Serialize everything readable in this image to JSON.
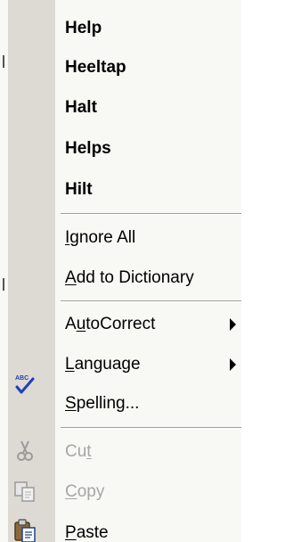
{
  "menu": {
    "suggestions": [
      {
        "label": "Help"
      },
      {
        "label": "Heeltap"
      },
      {
        "label": "Halt"
      },
      {
        "label": "Helps"
      },
      {
        "label": "Hilt"
      }
    ],
    "ignore_all": {
      "pre": "",
      "accel": "I",
      "post": "gnore All"
    },
    "add_to_dictionary": {
      "pre": "",
      "accel": "A",
      "post": "dd to Dictionary"
    },
    "autocorrect": {
      "pre": "A",
      "accel": "u",
      "post": "toCorrect"
    },
    "language": {
      "pre": "",
      "accel": "L",
      "post": "anguage"
    },
    "spelling": {
      "pre": "",
      "accel": "S",
      "post": "pelling..."
    },
    "cut": {
      "pre": "Cu",
      "accel": "t",
      "post": "",
      "enabled": false
    },
    "copy": {
      "pre": "",
      "accel": "C",
      "post": "opy",
      "enabled": false
    },
    "paste": {
      "pre": "",
      "accel": "P",
      "post": "aste",
      "enabled": true
    }
  },
  "icons": {
    "spelling": "spelling-check-icon",
    "cut": "scissors-icon",
    "copy": "copy-icon",
    "paste": "clipboard-paste-icon"
  },
  "colors": {
    "menu_background": "#f8f8f5",
    "icon_strip": "#dcdad2",
    "disabled_text": "#a6a6a6",
    "spell_check_blue": "#1f3fb7"
  }
}
